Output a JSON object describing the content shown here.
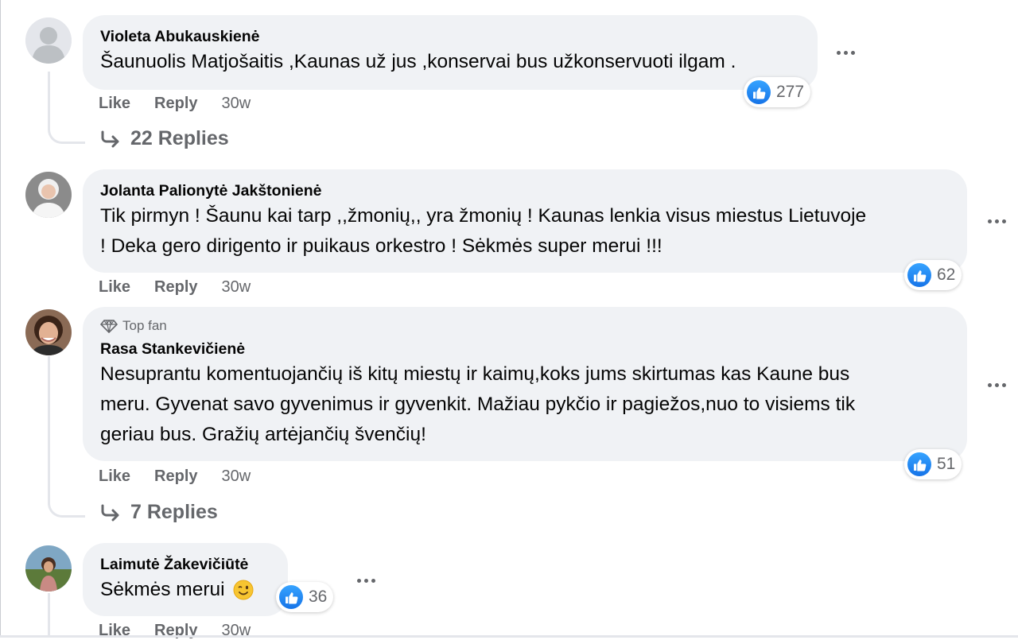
{
  "comments": [
    {
      "author": "Violeta Abukauskienė",
      "text": "Šaunuolis Matjošaitis ,Kaunas už jus ,konservai bus užkonservuoti ilgam .",
      "reactions": "277",
      "like": "Like",
      "reply": "Reply",
      "time": "30w",
      "replies": "22 Replies",
      "avatar": "default-avatar-icon"
    },
    {
      "author": "Jolanta Palionytė Jakštonienė",
      "text_line1": "Tik pirmyn ! Šaunu kai tarp ,,žmonių,, yra žmonių ! Kaunas lenkia visus miestus Lietuvoje",
      "text_line2": "! Deka gero dirigento ir puikaus orkestro ! Sėkmės super merui !!!",
      "reactions": "62",
      "like": "Like",
      "reply": "Reply",
      "time": "30w"
    },
    {
      "badge": "Top fan",
      "author": "Rasa Stankevičienė",
      "text_line1": "Nesuprantu komentuojančių iš kitų miestų ir kaimų,koks jums skirtumas kas Kaune bus",
      "text_line2": "meru. Gyvenat savo gyvenimus ir gyvenkit. Mažiau pykčio ir pagiežos,nuo to visiems tik",
      "text_line3": "geriau bus. Gražių artėjančių švenčių!",
      "reactions": "51",
      "like": "Like",
      "reply": "Reply",
      "time": "30w",
      "replies": "7 Replies"
    },
    {
      "author": "Laimutė Žakevičiūtė",
      "text": "Sėkmės merui",
      "emoji": "😉",
      "reactions": "36",
      "like": "Like",
      "reply": "Reply",
      "time": "30w"
    }
  ],
  "colors": {
    "bubble": "#f0f2f5",
    "like_blue": "#1877f2",
    "secondary_text": "#65676b",
    "thread_line": "#e4e6eb"
  },
  "icons": {
    "reaction": "like-thumb-icon",
    "more": "more-dots-icon",
    "reply_arrow": "reply-arrow-icon",
    "top_fan": "diamond-icon"
  }
}
